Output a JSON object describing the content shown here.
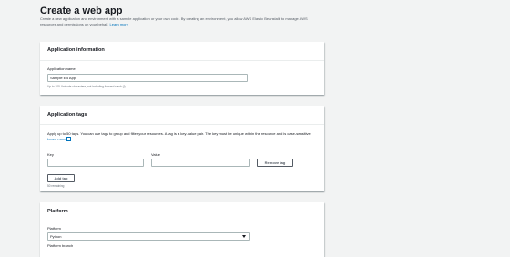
{
  "page": {
    "title": "Create a web app",
    "description": "Create a new application and environment with a sample application or your own code. By creating an environment, you allow AWS Elastic Beanstalk to manage AWS resources and permissions on your behalf.",
    "learn_more": "Learn more"
  },
  "app_info": {
    "title": "Application information",
    "name_label": "Application name",
    "name_value": "Sample EB App",
    "name_hint": "Up to 100 Unicode characters, not including forward slash (/)."
  },
  "tags": {
    "title": "Application tags",
    "description": "Apply up to 50 tags. You can use tags to group and filter your resources. A tag is a key-value pair. The key must be unique within the resource and is case-sensitive.",
    "learn_more": "Learn more",
    "key_label": "Key",
    "value_label": "Value",
    "remove_label": "Remove tag",
    "add_label": "Add tag",
    "remaining": "50 remaining"
  },
  "platform": {
    "title": "Platform",
    "platform_label": "Platform",
    "platform_value": "Python",
    "branch_label": "Platform branch"
  },
  "colors": {
    "link": "#0073bb",
    "background": "#f2f3f3"
  }
}
